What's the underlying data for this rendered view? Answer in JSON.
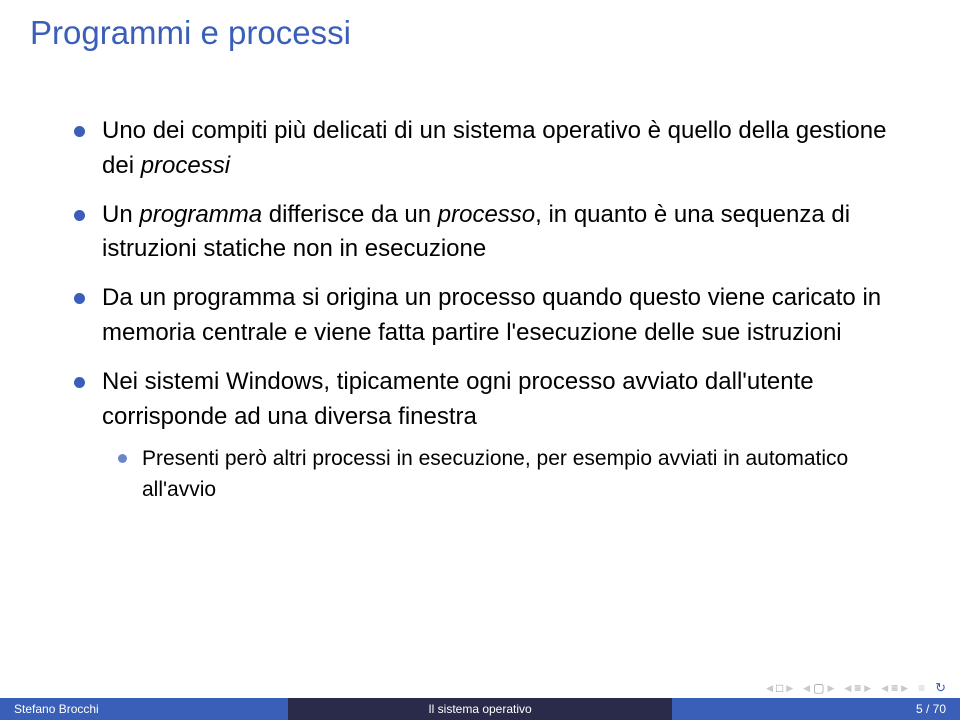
{
  "title": "Programmi e processi",
  "bullets": [
    {
      "pre": "Uno dei compiti più delicati di un sistema operativo è quello della gestione dei ",
      "em": "processi"
    },
    {
      "pre": "Un ",
      "em1": "programma",
      "mid": " differisce da un ",
      "em2": "processo",
      "post": ", in quanto è una sequenza di istruzioni statiche non in esecuzione"
    },
    {
      "text": "Da un programma si origina un processo quando questo viene caricato in memoria centrale e viene fatta partire l'esecuzione delle sue istruzioni"
    },
    {
      "text": "Nei sistemi Windows, tipicamente ogni processo avviato dall'utente corrisponde ad una diversa finestra",
      "sub": [
        "Presenti però altri processi in esecuzione, per esempio avviati in automatico all'avvio"
      ]
    }
  ],
  "footer": {
    "author": "Stefano Brocchi",
    "title": "Il sistema operativo",
    "page": "5 / 70"
  }
}
